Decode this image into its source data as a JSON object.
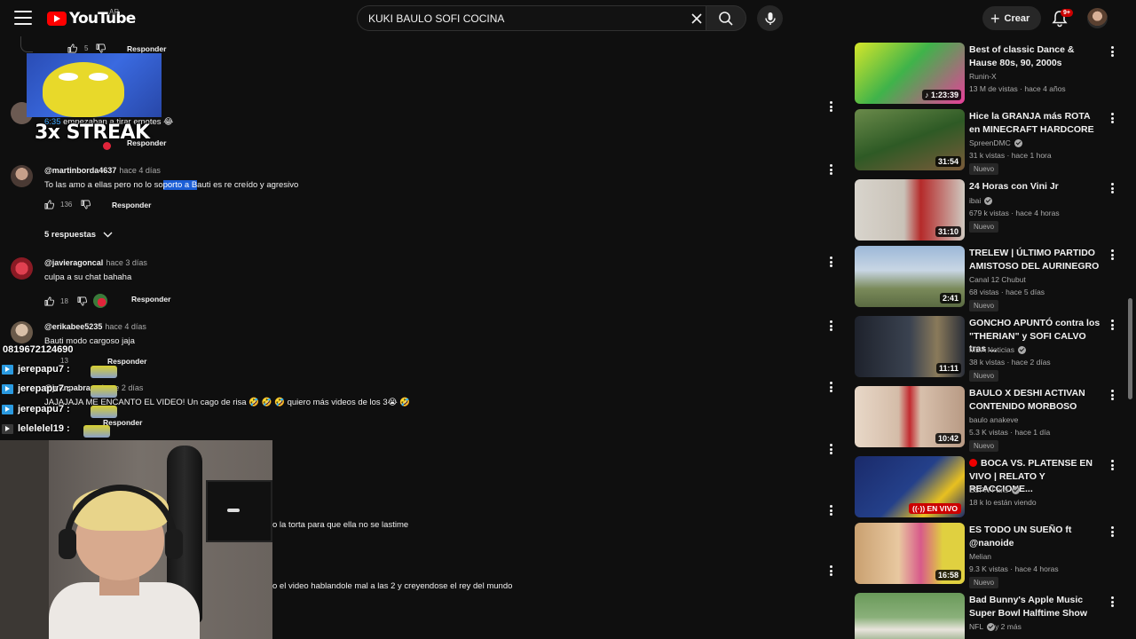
{
  "header": {
    "logo_text": "YouTube",
    "country": "AR",
    "search_value": "KUKI BAULO SOFI COCINA",
    "create_label": "Crear",
    "notif_count": "9+"
  },
  "comments": {
    "top_likes": "5",
    "reply_label": "Responder",
    "c1": {
      "timestamp": "6:35",
      "text": " empezaban a tirar emotes 😂"
    },
    "c2": {
      "handle": "@martinborda4637",
      "time": "hace 4 días",
      "text_a": "To las amo a ellas pero no lo so",
      "text_sel": "porto a B",
      "text_b": "auti es re creído y agresivo",
      "likes": "136"
    },
    "replies_toggle": "5 respuestas",
    "c3": {
      "handle": "@javieragoncal",
      "time": "hace 3 días",
      "text": "culpa a su chat bahaha",
      "likes": "18"
    },
    "c4": {
      "handle": "@erikabee5235",
      "time": "hace 4 días",
      "text": "Bauti  modo cargoso jaja",
      "likes": "13"
    },
    "c5": {
      "handle": "@juanpabrazo",
      "time": "hace 2 días",
      "text": "JAJAJAJA ME ENCANTO EL VIDEO! Un cago de risa 🤣 🤣 🤣  quiero más videos de los 3😭 🤣"
    },
    "c6": {
      "text": "o la torta para que ella no se lastime"
    },
    "c7": {
      "text": "o el video hablandole mal a las 2 y creyendose el rey del mundo"
    }
  },
  "overlay": {
    "streak": "3x STREAK",
    "chat_number": "0819672124690",
    "chat": [
      {
        "user": "jerepapu7 :"
      },
      {
        "user": "jerepapu7 :"
      },
      {
        "user": "jerepapu7 :"
      },
      {
        "user": "lelelelel19 :"
      }
    ]
  },
  "sidebar": {
    "videos": [
      {
        "title": "Best of classic Dance & Hause 80s, 90, 2000s",
        "channel": "Runin-X",
        "verified": false,
        "meta": "13 M de vistas · hace 4 años",
        "duration": "1:23:39",
        "badge": "",
        "thumb_color": "#8bbf2a"
      },
      {
        "title": "Hice la GRANJA más ROTA en MINECRAFT HARDCORE",
        "channel": "SpreenDMC",
        "verified": true,
        "meta": "31 k vistas · hace 1 hora",
        "duration": "31:54",
        "badge": "Nuevo",
        "thumb_color": "#3d7a2e"
      },
      {
        "title": "24 Horas con Vini Jr",
        "channel": "ibai",
        "verified": true,
        "meta": "679 k vistas · hace 4 horas",
        "duration": "31:10",
        "badge": "Nuevo",
        "thumb_color": "#b8b2a8"
      },
      {
        "title": "TRELEW | ÚLTIMO PARTIDO AMISTOSO DEL AURINEGRO",
        "channel": "Canal 12 Chubut",
        "verified": false,
        "meta": "68 vistas · hace 5 días",
        "duration": "2:41",
        "badge": "Nuevo",
        "thumb_color": "#6e8fb5"
      },
      {
        "title": "GONCHO APUNTÓ contra los \"THERIAN\" y SOFI CALVO tras ...",
        "channel": "MDA Noticias",
        "verified": true,
        "meta": "38 k vistas · hace 2 días",
        "duration": "11:11",
        "badge": "Nuevo",
        "thumb_color": "#2a2e38"
      },
      {
        "title": "BAULO X DESHI ACTIVAN CONTENIDO MORBOSO",
        "channel": "baulo anakeve",
        "verified": false,
        "meta": "5.3 K vistas · hace 1 día",
        "duration": "10:42",
        "badge": "Nuevo",
        "thumb_color": "#d9c2b0"
      },
      {
        "title": "BOCA VS. PLATENSE EN VIVO | RELATO Y REACCIONE...",
        "channel": "ESPN Fans",
        "verified": true,
        "meta": "18 k lo están viendo",
        "duration": "",
        "live": "EN VIVO",
        "badge": "",
        "thumb_color": "#1c2e6a"
      },
      {
        "title": "ES TODO UN SUEÑO ft @nanoide",
        "channel": "Melian",
        "verified": false,
        "meta": "9.3 K vistas · hace 4 horas",
        "duration": "16:58",
        "badge": "Nuevo",
        "thumb_color": "#c9a070"
      },
      {
        "title": "Bad Bunny's Apple Music Super Bowl Halftime Show",
        "channel": "NFL",
        "verified": true,
        "channel_extra": " y 2 más",
        "meta": "",
        "duration": "",
        "badge": "",
        "thumb_color": "#5d8a4e"
      }
    ]
  }
}
